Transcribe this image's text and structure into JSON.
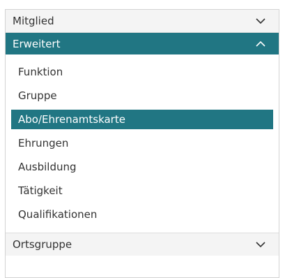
{
  "accordion": {
    "sections": [
      {
        "label": "Mitglied",
        "icon": "chevron-down-icon"
      },
      {
        "label": "Erweitert",
        "icon": "chevron-up-icon"
      },
      {
        "label": "Ortsgruppe",
        "icon": "chevron-down-icon"
      }
    ],
    "items": [
      {
        "label": "Funktion"
      },
      {
        "label": "Gruppe"
      },
      {
        "label": "Abo/Ehrenamtskarte",
        "selected": true
      },
      {
        "label": "Ehrungen"
      },
      {
        "label": "Ausbildung"
      },
      {
        "label": "Tätigkeit"
      },
      {
        "label": "Qualifikationen"
      }
    ]
  },
  "colors": {
    "accent": "#217683",
    "header_bg": "#f4f4f4",
    "text": "#333333",
    "border": "#d3d3d3"
  }
}
